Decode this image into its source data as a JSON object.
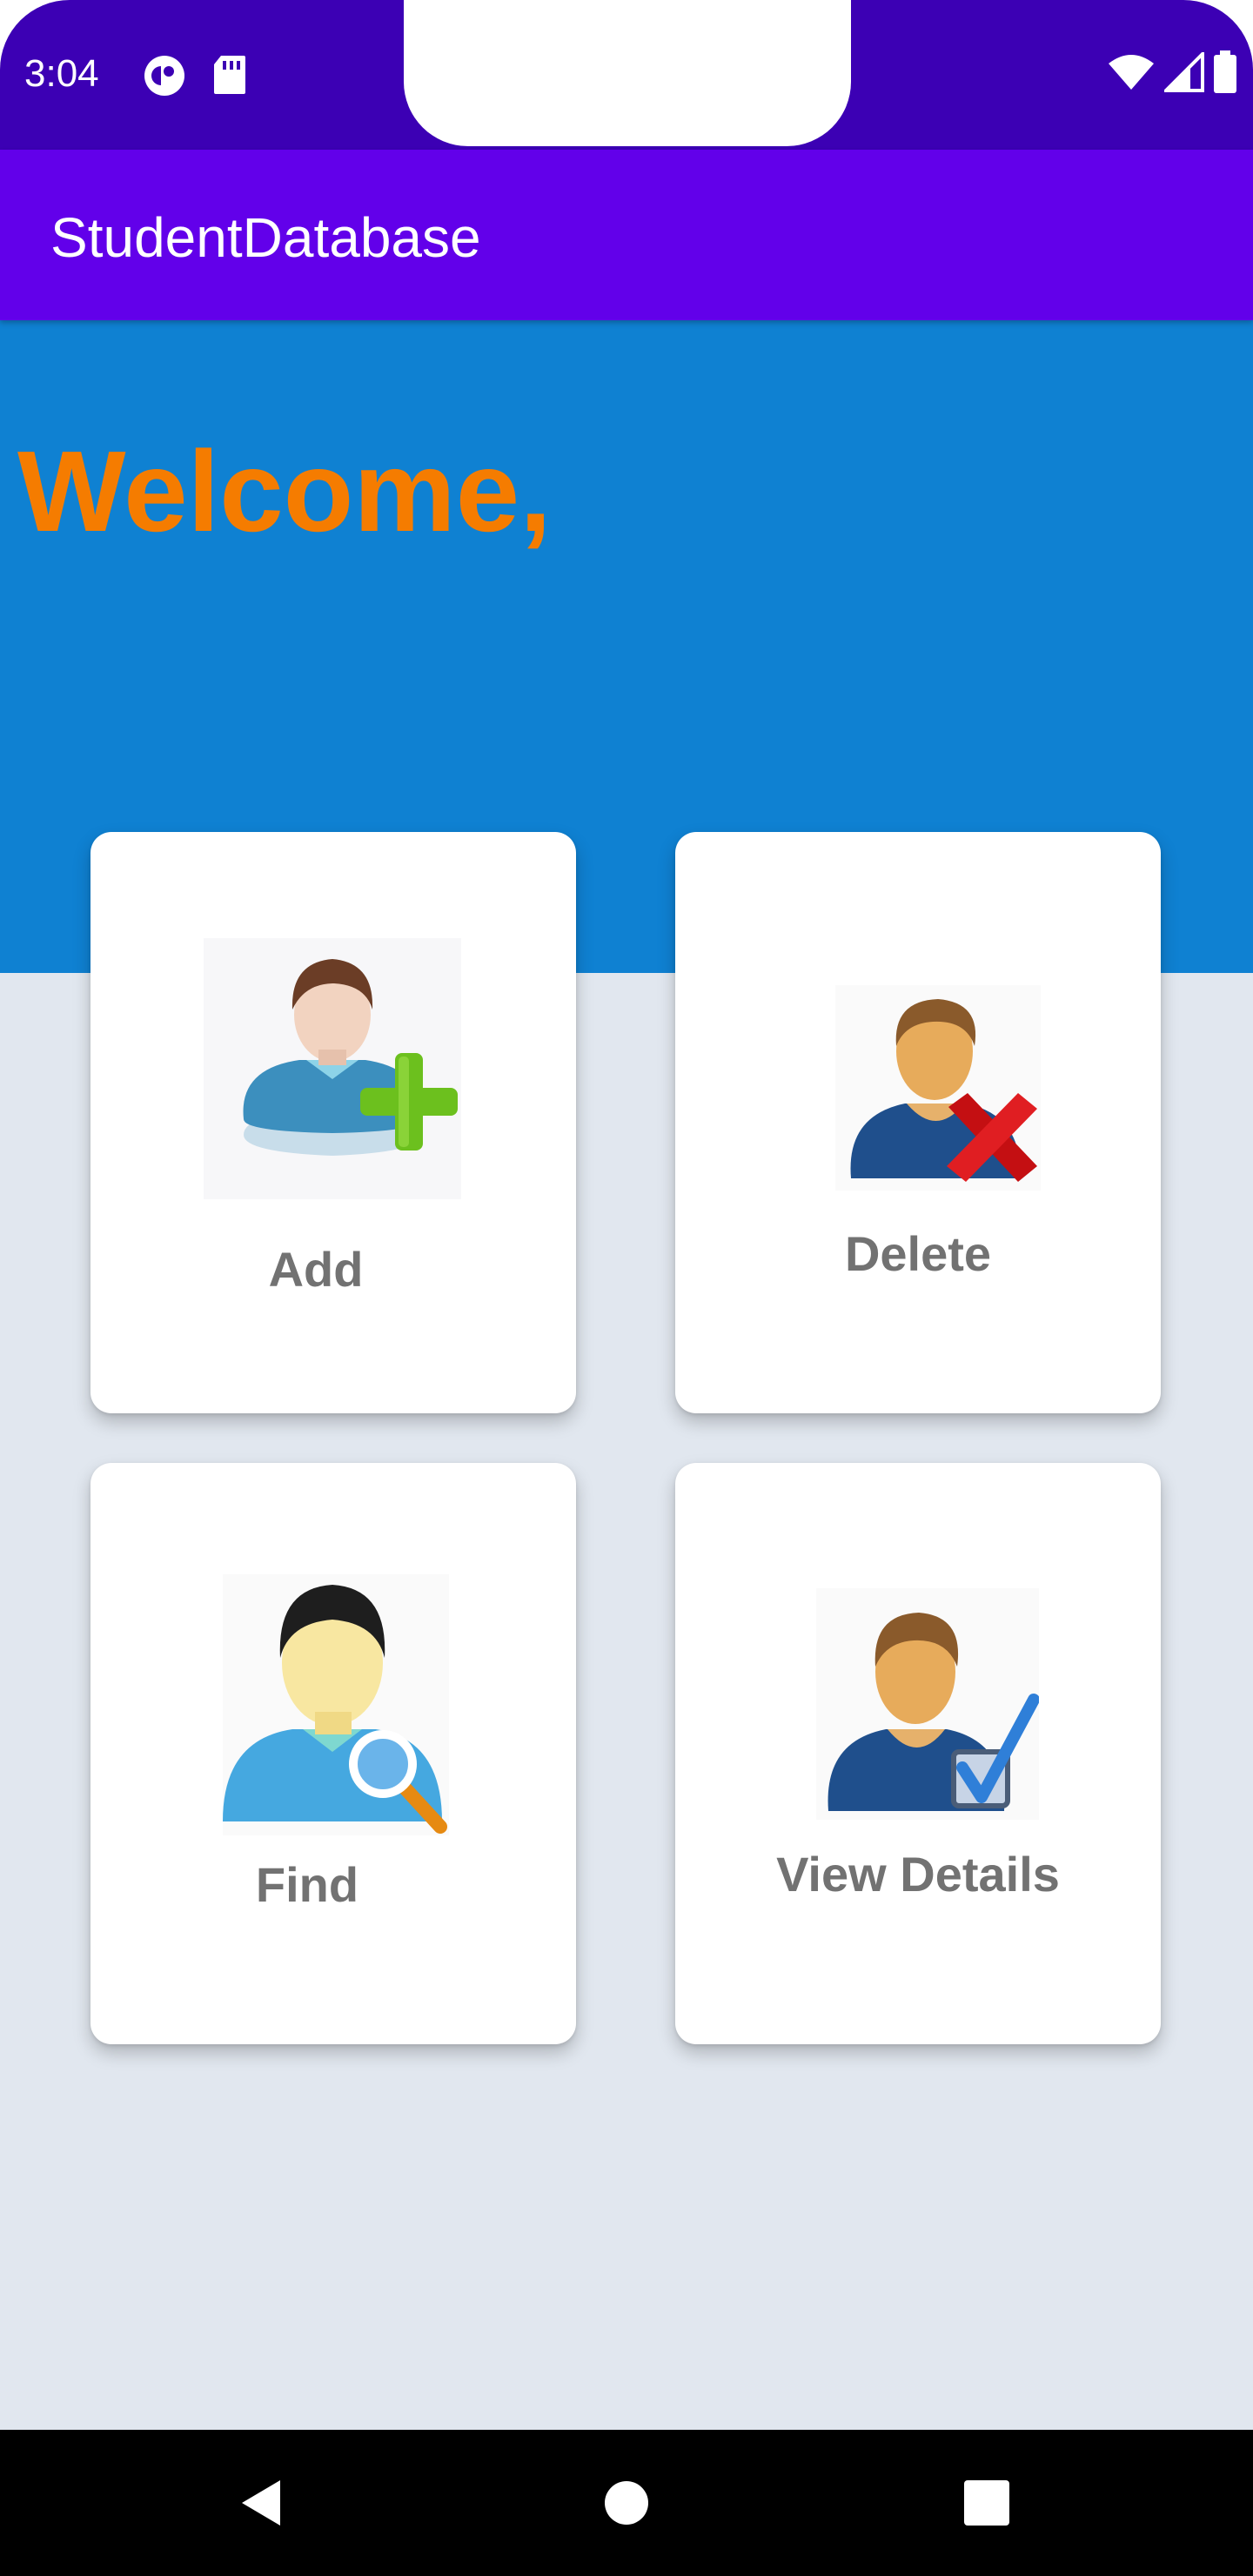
{
  "status_bar": {
    "time": "3:04",
    "left_icons": [
      "c-circle-icon",
      "sd-card-icon"
    ],
    "right_icons": [
      "wifi-icon",
      "signal-icon",
      "battery-icon"
    ],
    "background_color": "#3c00b4"
  },
  "app_bar": {
    "title": "StudentDatabase",
    "background_color": "#6200ea"
  },
  "header": {
    "welcome_text": "Welcome,",
    "background_color": "#0f81d2",
    "welcome_color": "#f57c00"
  },
  "cards": [
    {
      "label": "Add",
      "icon": "add-user-icon"
    },
    {
      "label": "Delete",
      "icon": "delete-user-icon"
    },
    {
      "label": "Find",
      "icon": "find-user-icon"
    },
    {
      "label": "View Details",
      "icon": "view-details-user-icon"
    }
  ],
  "nav_bar": {
    "buttons": [
      "back-icon",
      "home-icon",
      "recents-icon"
    ]
  },
  "colors": {
    "page_background": "#e1e7ef",
    "card_label": "#727272"
  }
}
